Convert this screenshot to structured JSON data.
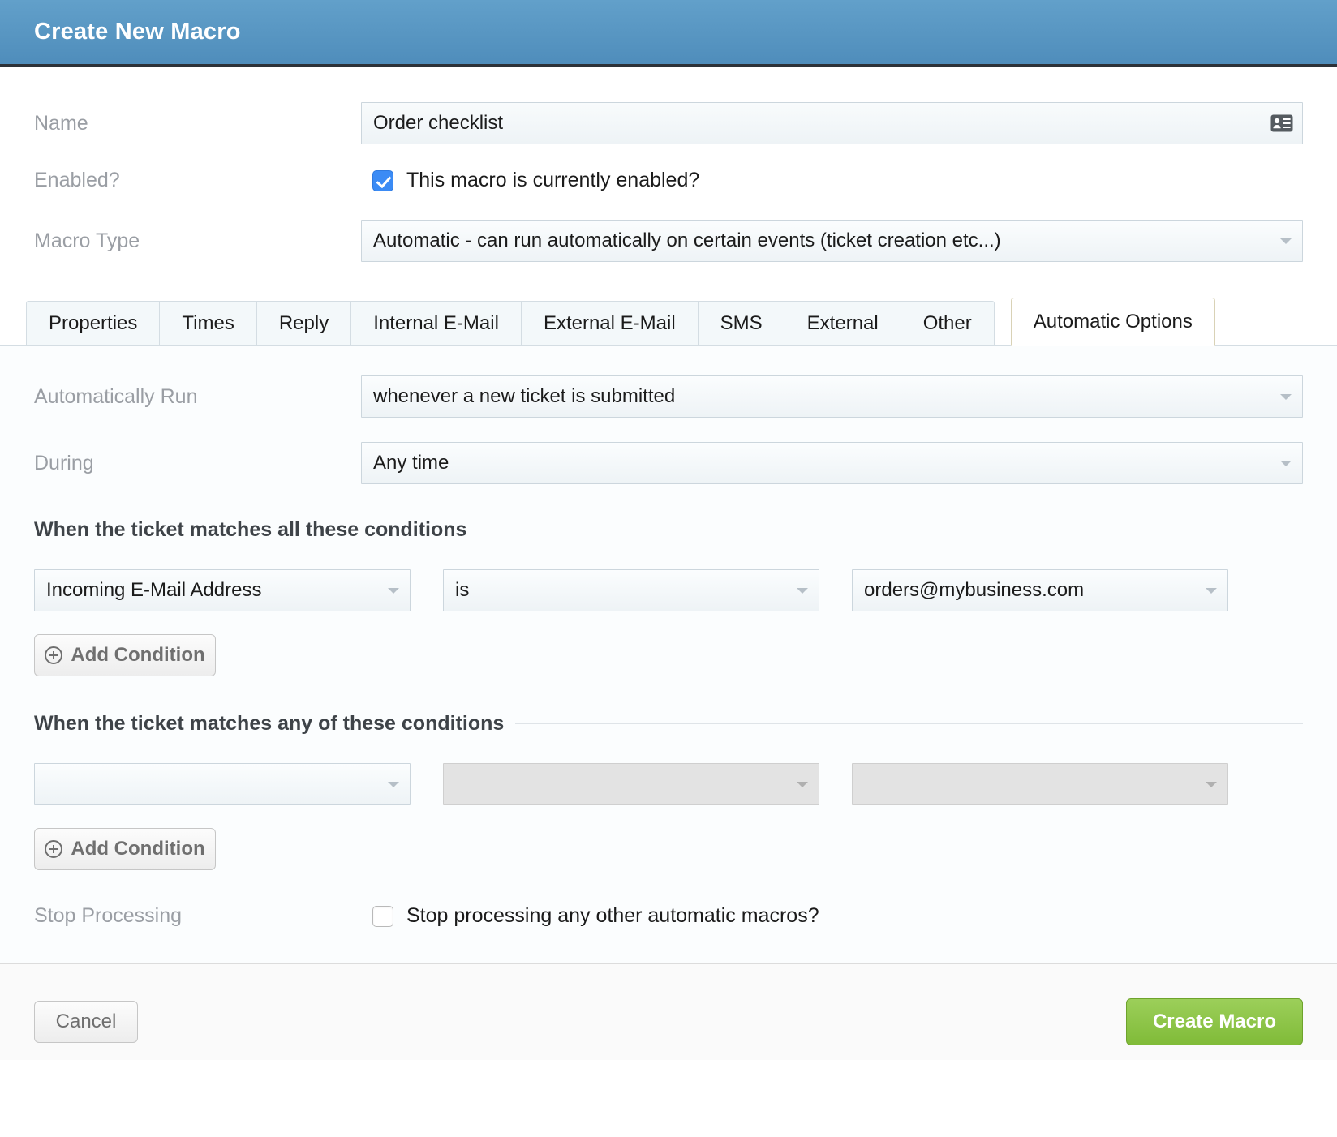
{
  "header": {
    "title": "Create New Macro"
  },
  "form": {
    "name": {
      "label": "Name",
      "value": "Order checklist",
      "placeholder": "",
      "icon": "contact-card-icon"
    },
    "enabled": {
      "label": "Enabled?",
      "checkbox_label": "This macro is currently enabled?",
      "checked": true
    },
    "macro_type": {
      "label": "Macro Type",
      "value": "Automatic - can run automatically on certain events (ticket creation etc...)"
    }
  },
  "tabs": {
    "items": [
      {
        "label": "Properties",
        "active": false
      },
      {
        "label": "Times",
        "active": false
      },
      {
        "label": "Reply",
        "active": false
      },
      {
        "label": "Internal E-Mail",
        "active": false
      },
      {
        "label": "External E-Mail",
        "active": false
      },
      {
        "label": "SMS",
        "active": false
      },
      {
        "label": "External",
        "active": false
      },
      {
        "label": "Other",
        "active": false
      },
      {
        "label": "Automatic Options",
        "active": true
      }
    ]
  },
  "panel": {
    "automatically_run": {
      "label": "Automatically Run",
      "value": "whenever a new ticket is submitted"
    },
    "during": {
      "label": "During",
      "value": "Any time"
    },
    "all_conditions": {
      "legend": "When the ticket matches all these conditions",
      "rows": [
        {
          "field": "Incoming E-Mail Address",
          "operator": "is",
          "value": "orders@mybusiness.com",
          "field_disabled": false,
          "operator_disabled": false,
          "value_disabled": false
        }
      ],
      "add_button": "Add Condition"
    },
    "any_conditions": {
      "legend": "When the ticket matches any of these conditions",
      "rows": [
        {
          "field": "",
          "operator": "",
          "value": "",
          "field_disabled": false,
          "operator_disabled": true,
          "value_disabled": true
        }
      ],
      "add_button": "Add Condition"
    },
    "stop_processing": {
      "label": "Stop Processing",
      "checkbox_label": "Stop processing any other automatic macros?",
      "checked": false
    }
  },
  "footer": {
    "cancel_label": "Cancel",
    "submit_label": "Create Macro"
  },
  "colors": {
    "header_blue": "#4f8dbb",
    "accent_checkbox": "#3b8bf5",
    "submit_green": "#80bb38",
    "active_tab_border": "#d9d2b6",
    "label_gray": "#9a9ea4"
  }
}
